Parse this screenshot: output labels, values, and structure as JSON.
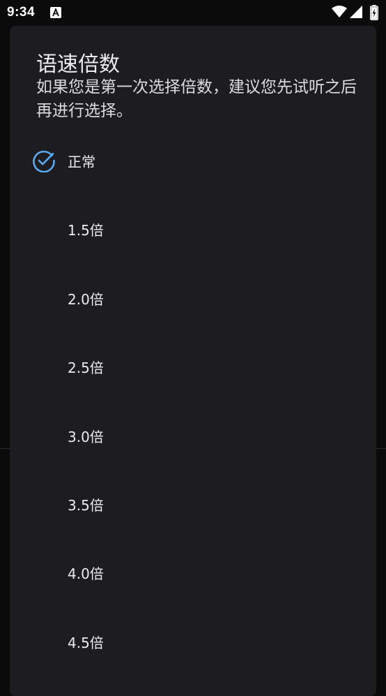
{
  "status_bar": {
    "time": "9:34",
    "notification_icon": "accessibility-a-icon",
    "wifi_icon": "wifi-icon",
    "signal_icon": "cell-signal-icon",
    "battery_icon": "battery-charging-icon"
  },
  "dialog": {
    "title": "语速倍数",
    "message": "如果您是第一次选择倍数，建议您先试听之后再进行选择。",
    "selected_index": 0,
    "check_icon": "check-circle-icon",
    "accent_color": "#5aa9f0",
    "options": [
      {
        "label": "正常"
      },
      {
        "label": "1.5倍"
      },
      {
        "label": "2.0倍"
      },
      {
        "label": "2.5倍"
      },
      {
        "label": "3.0倍"
      },
      {
        "label": "3.5倍"
      },
      {
        "label": "4.0倍"
      },
      {
        "label": "4.5倍"
      }
    ]
  }
}
